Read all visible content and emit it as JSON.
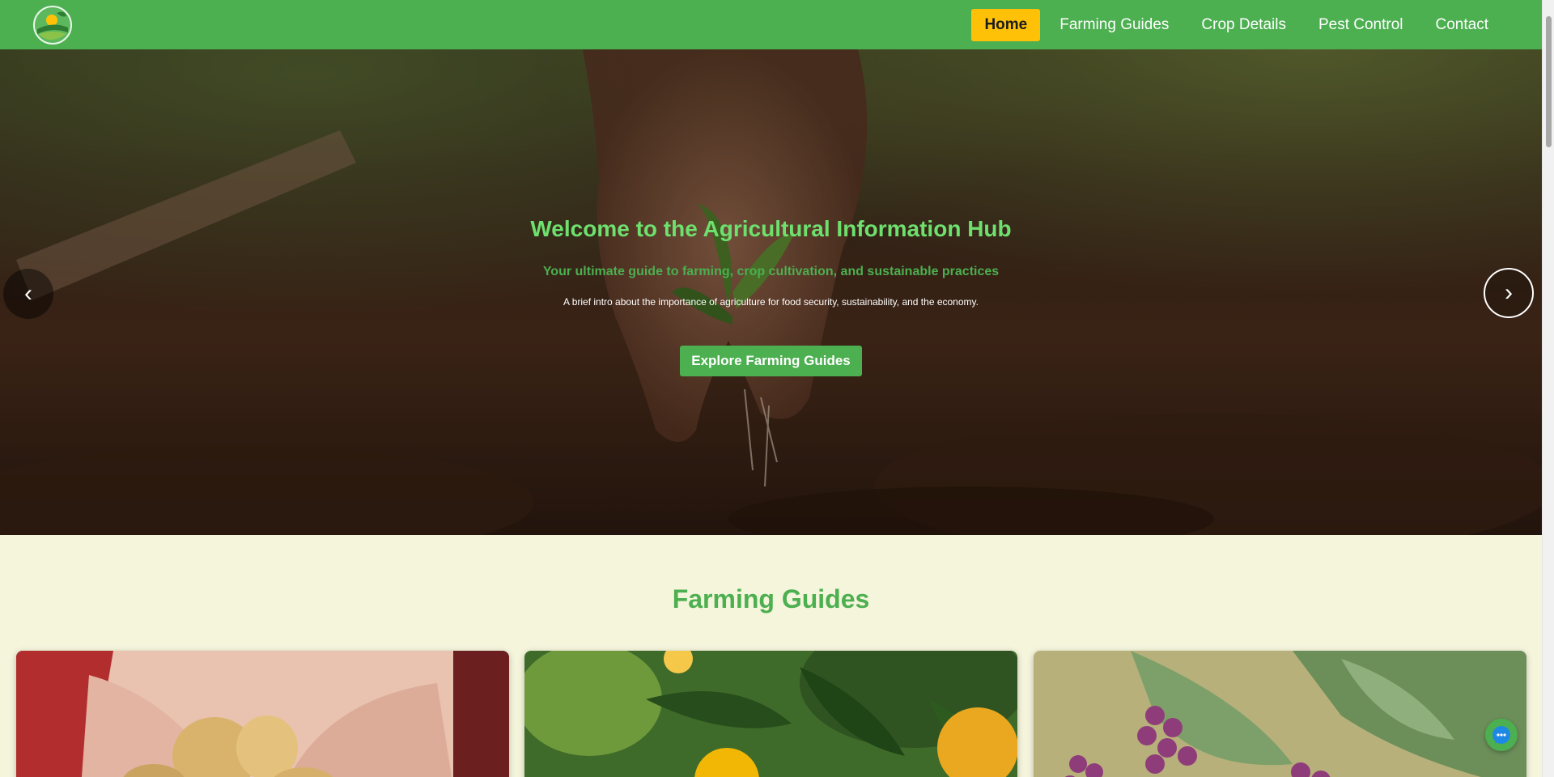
{
  "nav": {
    "logo_icon": "farm-sun-leaf-logo",
    "items": [
      {
        "label": "Home",
        "active": true
      },
      {
        "label": "Farming Guides",
        "active": false
      },
      {
        "label": "Crop Details",
        "active": false
      },
      {
        "label": "Pest Control",
        "active": false
      },
      {
        "label": "Contact",
        "active": false
      }
    ]
  },
  "hero": {
    "title": "Welcome to the Agricultural Information Hub",
    "subtitle": "Your ultimate guide to farming, crop cultivation, and sustainable practices",
    "intro": "A brief intro about the importance of agriculture for food security, sustainability, and the economy.",
    "cta_label": "Explore Farming Guides",
    "prev_arrow": "‹",
    "next_arrow": "›"
  },
  "guides": {
    "title": "Farming Guides",
    "cards": [
      {
        "image": "potatoes-in-hands"
      },
      {
        "image": "lemons-on-tree"
      },
      {
        "image": "grapes-on-vine"
      }
    ]
  },
  "colors": {
    "primary": "#4caf50",
    "accent": "#ffc107",
    "hero_title": "#6ee06e",
    "background": "#f5f5dc"
  }
}
